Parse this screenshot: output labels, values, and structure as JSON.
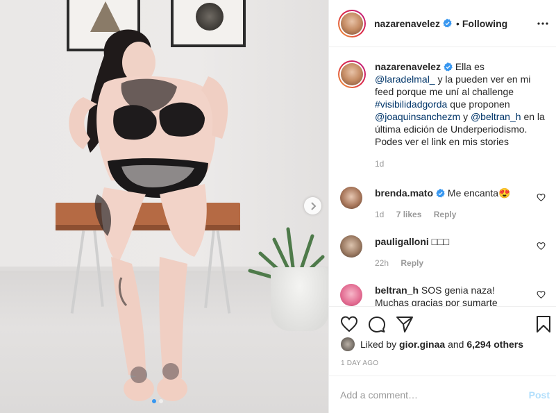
{
  "post": {
    "username": "nazarenavelez",
    "separator": "•",
    "follow_status": "Following"
  },
  "caption": {
    "author": "nazarenavelez",
    "text_1": "Ella es",
    "mention_1": "@laradelmal_",
    "text_2": "y la pueden ver en mi feed porque me uní al challenge",
    "hashtag": "#visibilidadgorda",
    "text_3": "que proponen",
    "mention_2": "@joaquinsanchezm",
    "text_4": "y",
    "mention_3": "@beltran_h",
    "text_5": "en la última edición de Underperiodismo. Podes ver el link en mis stories",
    "time": "1d"
  },
  "comments": [
    {
      "author": "brenda.mato",
      "verified": true,
      "text": "Me encanta😍",
      "time": "1d",
      "likes": "7 likes",
      "reply": "Reply"
    },
    {
      "author": "pauligalloni",
      "verified": false,
      "text": "□□□",
      "time": "22h",
      "reply": "Reply"
    },
    {
      "author": "beltran_h",
      "verified": false,
      "text": "SOS genia naza!",
      "text_2": "Muchas gracias por sumarte"
    }
  ],
  "likes": {
    "prefix": "Liked by",
    "user": "gior.ginaa",
    "and": "and",
    "others": "6,294 others"
  },
  "timestamp": "1 DAY AGO",
  "add_comment": {
    "placeholder": "Add a comment…",
    "post_label": "Post"
  },
  "colors": {
    "link": "#003569",
    "verified": "#3897f0",
    "muted": "#999999",
    "post_disabled": "#b2dffc"
  },
  "icons": [
    "verified-badge-icon",
    "more-options-icon",
    "heart-icon",
    "comment-icon",
    "share-icon",
    "bookmark-icon",
    "chevron-right-icon"
  ]
}
